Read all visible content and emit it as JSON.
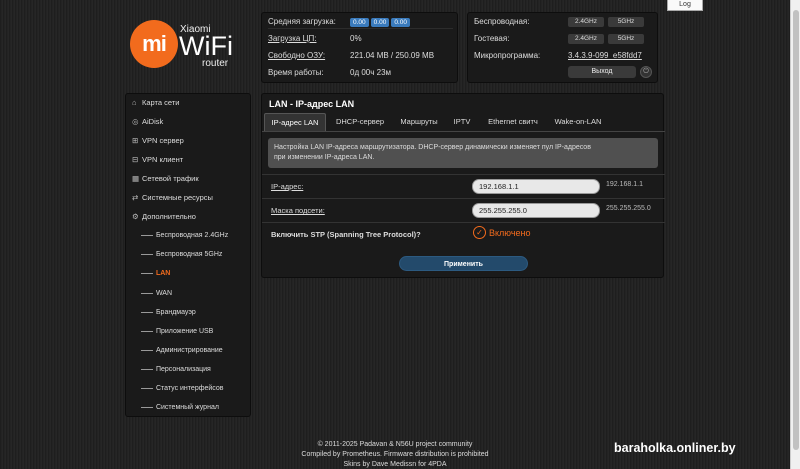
{
  "log_label": "Log",
  "logo": {
    "mi": "mi",
    "brand": "Xiaomi",
    "wifi": "WiFi",
    "router": "router"
  },
  "status": {
    "cpu_load_label": "Средняя загрузка:",
    "cpu_load_values": [
      "0.00",
      "0.00",
      "0.00"
    ],
    "cpu_usage_label": "Загрузка ЦП:",
    "cpu_usage_value": "0%",
    "ram_label": "Свободно ОЗУ:",
    "ram_value": "221.04 MB / 250.09 MB",
    "uptime_label": "Время работы:",
    "uptime_value": "0д 00ч 23м"
  },
  "network": {
    "wireless_label": "Беспроводная:",
    "guest_label": "Гостевая:",
    "band_24": "2.4GHz",
    "band_5": "5GHz",
    "firmware_label": "Микропрограмма:",
    "firmware_value": "3.4.3.9-099_e58fdd7",
    "exit_label": "Выход"
  },
  "sidebar": {
    "items": [
      {
        "icon": "map-icon",
        "label": "Карта сети"
      },
      {
        "icon": "disk-icon",
        "label": "AiDisk"
      },
      {
        "icon": "vpn-server-icon",
        "label": "VPN сервер"
      },
      {
        "icon": "vpn-client-icon",
        "label": "VPN клиент"
      },
      {
        "icon": "traffic-icon",
        "label": "Сетевой трафик"
      },
      {
        "icon": "resources-icon",
        "label": "Системные ресурсы"
      },
      {
        "icon": "settings-icon",
        "label": "Дополнительно"
      }
    ],
    "subitems": [
      "Беспроводная 2.4GHz",
      "Беспроводная 5GHz",
      "LAN",
      "WAN",
      "Брандмауэр",
      "Приложение USB",
      "Администрирование",
      "Персонализация",
      "Статус интерфейсов",
      "Системный журнал"
    ],
    "active_subitem": "LAN"
  },
  "main": {
    "title": "LAN - IP-адрес LAN",
    "tabs": [
      "IP-адрес LAN",
      "DHCP-сервер",
      "Маршруты",
      "IPTV",
      "Ethernet свитч",
      "Wake-on-LAN"
    ],
    "active_tab": "IP-адрес LAN",
    "info_line1": "Настройка LAN IP-адреса маршрутизатора. DHCP-сервер динамически изменяет пул IP-адресов",
    "info_line2": "при изменении IP-адреса LAN.",
    "ip_label": "IP-адрес:",
    "ip_value": "192.168.1.1",
    "ip_default": "192.168.1.1",
    "mask_label": "Маска подсети:",
    "mask_value": "255.255.255.0",
    "mask_default": "255.255.255.0",
    "stp_label": "Включить STP (Spanning Tree Protocol)?",
    "stp_value": "Включено",
    "apply_label": "Применить"
  },
  "footer": {
    "line1": "© 2011-2025 Padavan & N56U project community",
    "line2": "Compiled by Prometheus. Firmware distribution is prohibited",
    "line3": "Skins by Dave Medissn for 4PDA"
  },
  "watermark": "baraholka.onliner.by",
  "colors": {
    "accent": "#f26b1d",
    "badge_blue": "#3a7bbd",
    "apply_bg": "#234a6b"
  }
}
